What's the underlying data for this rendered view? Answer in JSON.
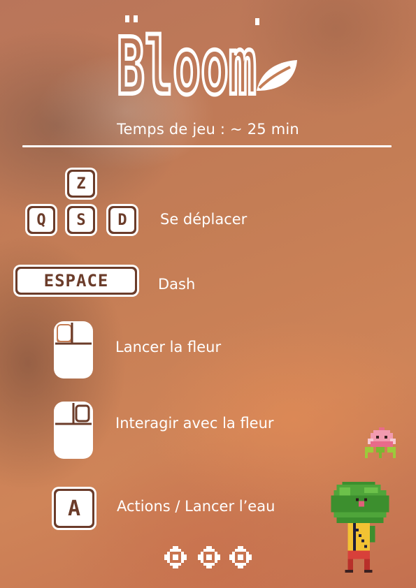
{
  "game": {
    "title": "Bloom",
    "playtime": "Temps de jeu : ~ 25 min"
  },
  "controls": [
    {
      "keys": [
        "Z",
        "Q",
        "S",
        "D"
      ],
      "action": "Se déplacer"
    },
    {
      "keys": [
        "ESPACE"
      ],
      "action": "Dash"
    },
    {
      "keys": [
        "left-mouse-button-icon"
      ],
      "action": "Lancer la fleur"
    },
    {
      "keys": [
        "right-mouse-button-icon"
      ],
      "action": "Interagir avec la fleur"
    },
    {
      "keys": [
        "A"
      ],
      "action": "Actions / Lancer l’eau"
    }
  ],
  "colors": {
    "background": "#c47d55",
    "text": "#ffffff",
    "key_outline": "#6b3c2a"
  }
}
